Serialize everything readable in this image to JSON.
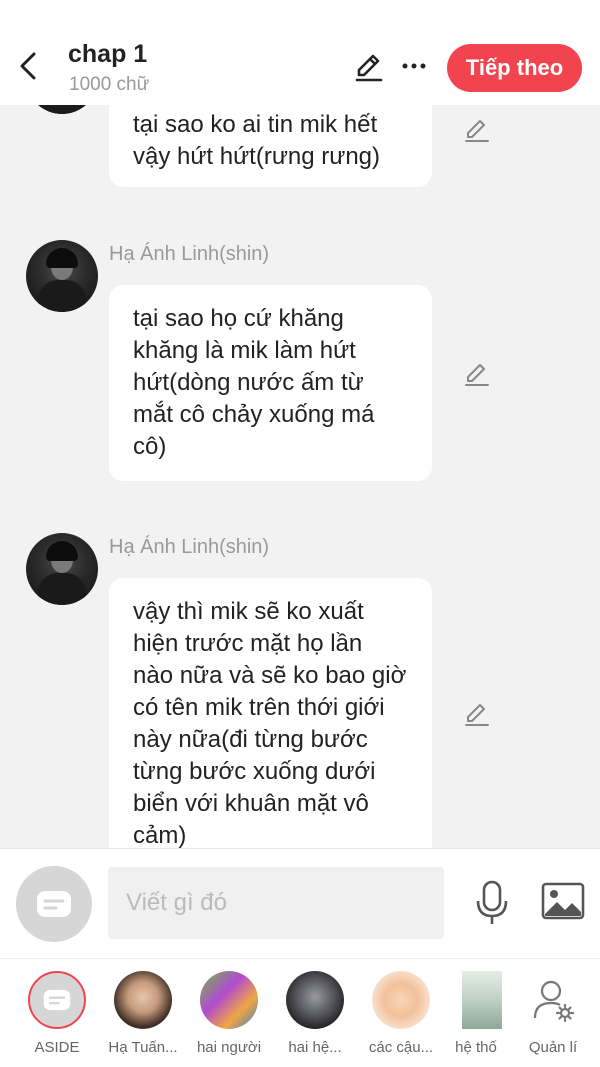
{
  "header": {
    "title": "chap 1",
    "subtitle": "1000 chữ",
    "next_label": "Tiếp theo"
  },
  "messages": [
    {
      "sender": "",
      "text": "tại sao ko ai tin mik hết vậy hứt hứt(rưng rưng)"
    },
    {
      "sender": "Hạ Ánh Linh(shin)",
      "text": "tại sao họ cứ khăng khăng là mik làm hứt hứt(dòng nước ấm từ mắt cô chảy xuống má cô)"
    },
    {
      "sender": "Hạ Ánh Linh(shin)",
      "text": "vậy thì mik sẽ ko xuất hiện trước mặt họ lần nào nữa và sẽ ko bao giờ có tên mik trên thới giới này nữa(đi từng bước từng bước xuống dưới biển với khuân mặt vô cảm)"
    }
  ],
  "composer": {
    "placeholder": "Viết gì đó"
  },
  "tabs": [
    {
      "label": "ASIDE"
    },
    {
      "label": "Hạ Tuấn..."
    },
    {
      "label": "hai người"
    },
    {
      "label": "hai hệ..."
    },
    {
      "label": "các cậu..."
    },
    {
      "label": "hệ thố"
    },
    {
      "label": "Quản lí"
    }
  ],
  "colors": {
    "accent": "#f2444e",
    "background": "#f2f2f2"
  },
  "icons": [
    "back-arrow-icon",
    "pencil-icon",
    "more-icon",
    "chat-bubble-icon",
    "microphone-icon",
    "image-icon",
    "user-settings-icon"
  ]
}
